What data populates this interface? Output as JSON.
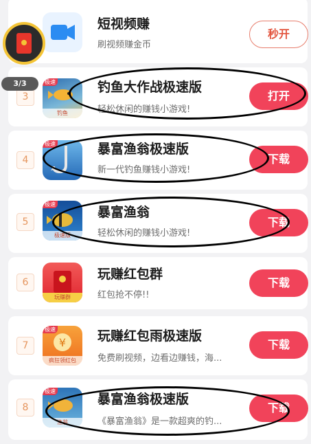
{
  "floating_widget": {
    "progress": "3/3"
  },
  "items": [
    {
      "rank": "",
      "title": "短视频赚",
      "desc": "刷视频赚金币",
      "button": "秒开",
      "button_style": "outline"
    },
    {
      "rank": "3",
      "title": "钓鱼大作战极速版",
      "desc": "轻松休闲的赚钱小游戏!",
      "button": "打开",
      "button_style": "filled"
    },
    {
      "rank": "4",
      "title": "暴富渔翁极速版",
      "desc": "新一代钓鱼赚钱小游戏!",
      "button": "下载",
      "button_style": "filled"
    },
    {
      "rank": "5",
      "title": "暴富渔翁",
      "desc": "轻松休闲的赚钱小游戏!",
      "button": "下载",
      "button_style": "filled"
    },
    {
      "rank": "6",
      "title": "玩赚红包群",
      "desc": "红包抢不停!!",
      "button": "下载",
      "button_style": "filled"
    },
    {
      "rank": "7",
      "title": "玩赚红包雨极速版",
      "desc": "免费刷视频，边看边赚钱，海...",
      "button": "下载",
      "button_style": "filled"
    },
    {
      "rank": "8",
      "title": "暴富渔翁极速版",
      "desc": "《暴富渔翁》是一款超爽的钓...",
      "button": "下载",
      "button_style": "filled"
    }
  ],
  "icon_labels": {
    "fishing_war": {
      "tag": "极速",
      "strip": "钓鱼"
    },
    "fisherman_lite": {
      "tag": "极速"
    },
    "fisherman": {
      "tag": "极速",
      "strip": "极速版"
    },
    "redpacket_group": {
      "strip": "玩赚群"
    },
    "redpacket_rain": {
      "tag": "极速",
      "strip": "疯狂领红包"
    },
    "fisherman_lite2": {
      "tag": "极速",
      "strip": "渔翁"
    }
  },
  "icons": {
    "item0": "video-camera-icon",
    "item1": "fishing-game-icon",
    "item2": "fishing-hook-icon",
    "item3": "tropical-fish-icon",
    "item4": "red-envelope-icon",
    "item5": "yen-coin-icon",
    "item6": "golden-fish-icon"
  },
  "colors": {
    "accent": "#f1435a",
    "rank_text": "#e5955d",
    "outline_button": "#e3553f"
  }
}
